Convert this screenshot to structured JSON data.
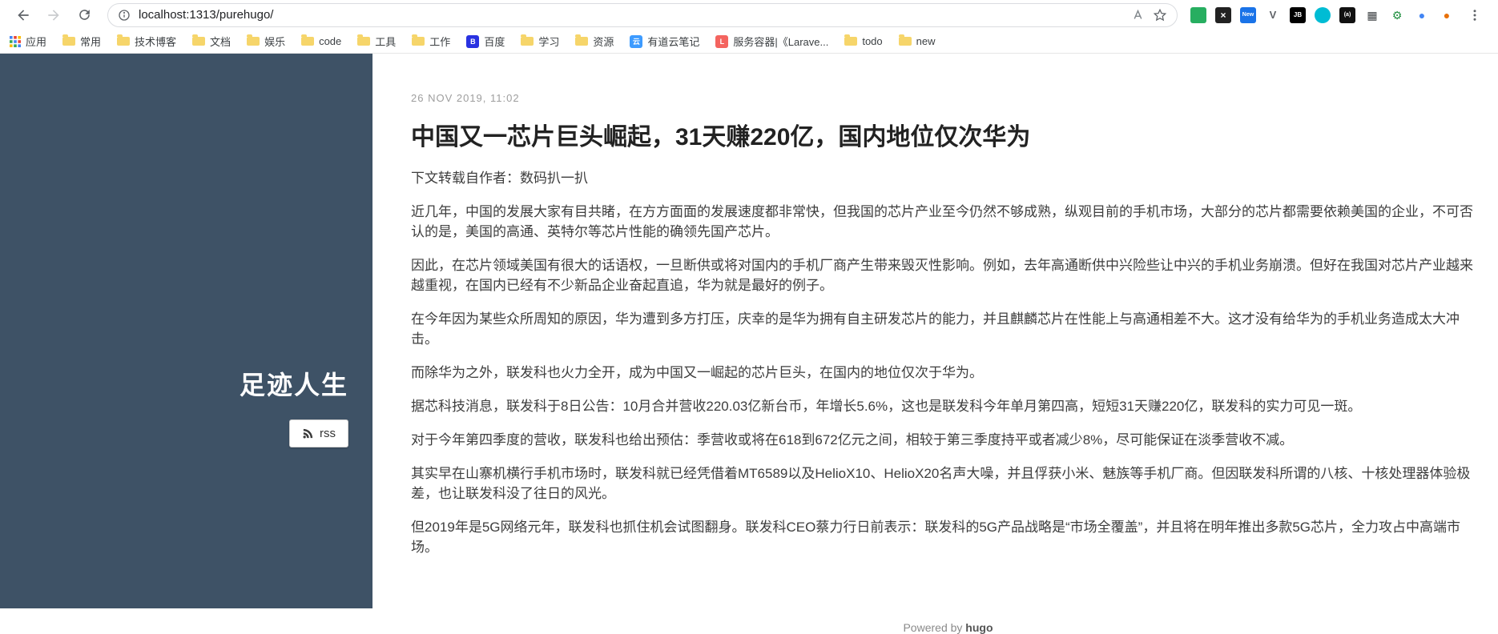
{
  "colors": {
    "sidebar_bg": "#3e5266",
    "title_color": "#222222",
    "body_text": "#3d3d3d",
    "date_color": "#9e9e9e",
    "folder_color": "#f6d56a"
  },
  "browser": {
    "url": "localhost:1313/purehugo/",
    "extensions": [
      {
        "glyph": "",
        "style": "background:#27ae60;color:#fff;border-radius:3px"
      },
      {
        "glyph": "×",
        "style": "background:#222;color:#fff;border-radius:3px;font-size:12px"
      },
      {
        "glyph": "New",
        "style": "background:#1a73e8;color:#fff;border-radius:3px;font-size:7px"
      },
      {
        "glyph": "V",
        "style": "color:#5f6368;font-size:13px"
      },
      {
        "glyph": "JB",
        "style": "background:#000;color:#fff;border-radius:3px;font-size:8px"
      },
      {
        "glyph": "",
        "style": "background:#00bcd4;border-radius:50%"
      },
      {
        "glyph": "(a)",
        "style": "background:#111;color:#fff;border-radius:3px;font-size:7px"
      },
      {
        "glyph": "▦",
        "style": "color:#3c4043;font-size:14px"
      },
      {
        "glyph": "⚙",
        "style": "color:#1e8e3e;font-size:14px"
      },
      {
        "glyph": "●",
        "style": "color:#4285f4;font-size:14px"
      },
      {
        "glyph": "●",
        "style": "color:#e8710a;font-size:14px"
      }
    ],
    "bookmarks": [
      {
        "label": "应用",
        "icon": "apps-grid-icon"
      },
      {
        "label": "常用",
        "icon": "folder-icon"
      },
      {
        "label": "技术博客",
        "icon": "folder-icon"
      },
      {
        "label": "文档",
        "icon": "folder-icon"
      },
      {
        "label": "娱乐",
        "icon": "folder-icon"
      },
      {
        "label": "code",
        "icon": "folder-icon"
      },
      {
        "label": "工具",
        "icon": "folder-icon"
      },
      {
        "label": "工作",
        "icon": "folder-icon"
      },
      {
        "label": "百度",
        "icon": "baidu-icon",
        "glyph": "B",
        "icon_style": "background:#2932e1;color:#fff"
      },
      {
        "label": "学习",
        "icon": "folder-icon"
      },
      {
        "label": "资源",
        "icon": "folder-icon"
      },
      {
        "label": "有道云笔记",
        "icon": "youdao-icon",
        "glyph": "云",
        "icon_style": "background:#3d9bff;color:#fff"
      },
      {
        "label": "服务容器|《Larave...",
        "icon": "laravel-icon",
        "glyph": "L",
        "icon_style": "background:#f4645f;color:#fff"
      },
      {
        "label": "todo",
        "icon": "folder-icon"
      },
      {
        "label": "new",
        "icon": "folder-icon"
      }
    ]
  },
  "sidebar": {
    "title": "足迹人生",
    "rss_label": "rss"
  },
  "article": {
    "date": "26 NOV 2019, 11:02",
    "title": "中国又一芯片巨头崛起，31天赚220亿，国内地位仅次华为",
    "author_line": "下文转载自作者：数码扒一扒",
    "paragraphs": [
      "近几年，中国的发展大家有目共睹，在方方面面的发展速度都非常快，但我国的芯片产业至今仍然不够成熟，纵观目前的手机市场，大部分的芯片都需要依赖美国的企业，不可否认的是，美国的高通、英特尔等芯片性能的确领先国产芯片。",
      "因此，在芯片领域美国有很大的话语权，一旦断供或将对国内的手机厂商产生带来毁灭性影响。例如，去年高通断供中兴险些让中兴的手机业务崩溃。但好在我国对芯片产业越来越重视，在国内已经有不少新品企业奋起直追，华为就是最好的例子。",
      "在今年因为某些众所周知的原因，华为遭到多方打压，庆幸的是华为拥有自主研发芯片的能力，并且麒麟芯片在性能上与高通相差不大。这才没有给华为的手机业务造成太大冲击。",
      "而除华为之外，联发科也火力全开，成为中国又一崛起的芯片巨头，在国内的地位仅次于华为。",
      "据芯科技消息，联发科于8日公告：10月合并营收220.03亿新台币，年增长5.6%，这也是联发科今年单月第四高，短短31天赚220亿，联发科的实力可见一斑。",
      "对于今年第四季度的营收，联发科也给出预估：季营收或将在618到672亿元之间，相较于第三季度持平或者减少8%，尽可能保证在淡季营收不减。",
      "其实早在山寨机横行手机市场时，联发科就已经凭借着MT6589以及HelioX10、HelioX20名声大噪，并且俘获小米、魅族等手机厂商。但因联发科所谓的八核、十核处理器体验极差，也让联发科没了往日的风光。",
      "但2019年是5G网络元年，联发科也抓住机会试图翻身。联发科CEO蔡力行日前表示：联发科的5G产品战略是“市场全覆盖”，并且将在明年推出多款5G芯片，全力攻占中高端市场。"
    ]
  },
  "footer": {
    "powered_by": "Powered by",
    "hugo": "hugo"
  }
}
